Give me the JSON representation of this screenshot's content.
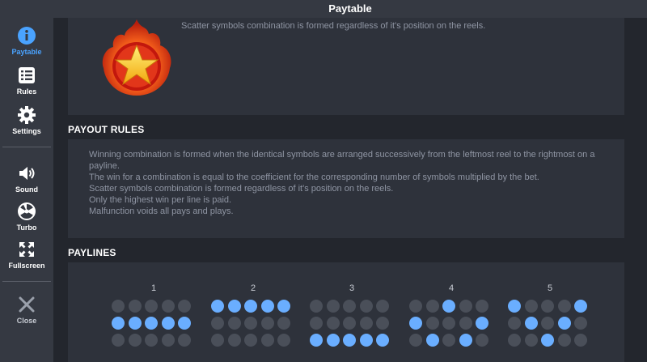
{
  "header": {
    "title": "Paytable"
  },
  "sidebar": {
    "items": [
      {
        "id": "paytable",
        "label": "Paytable",
        "icon": "info-icon",
        "active": true
      },
      {
        "id": "rules",
        "label": "Rules",
        "icon": "list-icon"
      },
      {
        "id": "settings",
        "label": "Settings",
        "icon": "gear-icon"
      },
      {
        "id": "sound",
        "label": "Sound",
        "icon": "speaker-icon"
      },
      {
        "id": "turbo",
        "label": "Turbo",
        "icon": "turbo-icon"
      },
      {
        "id": "fullscreen",
        "label": "Fullscreen",
        "icon": "fullscreen-icon"
      },
      {
        "id": "close",
        "label": "Close",
        "icon": "close-icon"
      }
    ]
  },
  "scatter": {
    "text": "Scatter symbols combination is formed regardless of it's position on the reels.",
    "icon": "scatter-star-icon"
  },
  "payout_rules": {
    "title": "PAYOUT RULES",
    "lines": [
      "Winning combination is formed when the identical symbols are arranged successively from the leftmost reel to the rightmost on a payline.",
      "The win for a combination is equal to the coefficient for the corresponding number of symbols multiplied by the bet.",
      "Scatter symbols combination is formed regardless of it's position on the reels.",
      "Only the highest win per line is paid.",
      "Malfunction voids all pays and plays."
    ]
  },
  "paylines": {
    "title": "PAYLINES",
    "lines": [
      {
        "number": "1",
        "rows": [
          1,
          1,
          1,
          1,
          1
        ]
      },
      {
        "number": "2",
        "rows": [
          0,
          0,
          0,
          0,
          0
        ]
      },
      {
        "number": "3",
        "rows": [
          2,
          2,
          2,
          2,
          2
        ]
      },
      {
        "number": "4",
        "rows": [
          1,
          2,
          0,
          2,
          1
        ]
      },
      {
        "number": "5",
        "rows": [
          0,
          1,
          2,
          1,
          0
        ]
      }
    ]
  },
  "colors": {
    "accent": "#4aa3ff",
    "dot_on": "#6aaeff",
    "dot_off": "#4a4f59",
    "sidebar_bg": "#353942",
    "panel_bg": "#2e323b",
    "page_bg": "#23262d"
  }
}
